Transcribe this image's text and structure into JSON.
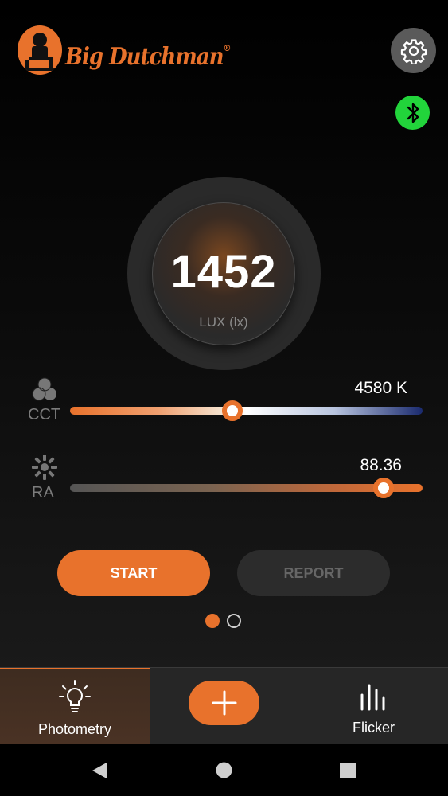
{
  "header": {
    "brand_name": "Big Dutchman",
    "brand_reg": "®",
    "settings_icon": "gear-icon",
    "bluetooth_icon": "bluetooth-icon"
  },
  "lux": {
    "value": "1452",
    "unit": "LUX (lx)"
  },
  "metrics": [
    {
      "label": "CCT",
      "icon": "color-circles-icon",
      "value_text": "4580 K",
      "slider_fraction": 0.46
    },
    {
      "label": "RA",
      "icon": "color-wheel-icon",
      "value_text": "88.36",
      "slider_fraction": 0.89
    }
  ],
  "actions": {
    "start_label": "START",
    "report_label": "REPORT"
  },
  "pager": {
    "pages": 2,
    "active": 1
  },
  "tabs": [
    {
      "label": "Photometry",
      "icon": "light-bulb-icon",
      "active": true
    },
    {
      "label": "",
      "icon": "plus-icon",
      "active": false
    },
    {
      "label": "Flicker",
      "icon": "bar-chart-icon",
      "active": false
    }
  ],
  "colors": {
    "accent": "#e8722c",
    "bluetooth": "#22d43b",
    "cct_warm": "#e8722c",
    "cct_cool": "#1a2a6e"
  },
  "system_nav": [
    "back-icon",
    "home-icon",
    "recents-icon"
  ]
}
